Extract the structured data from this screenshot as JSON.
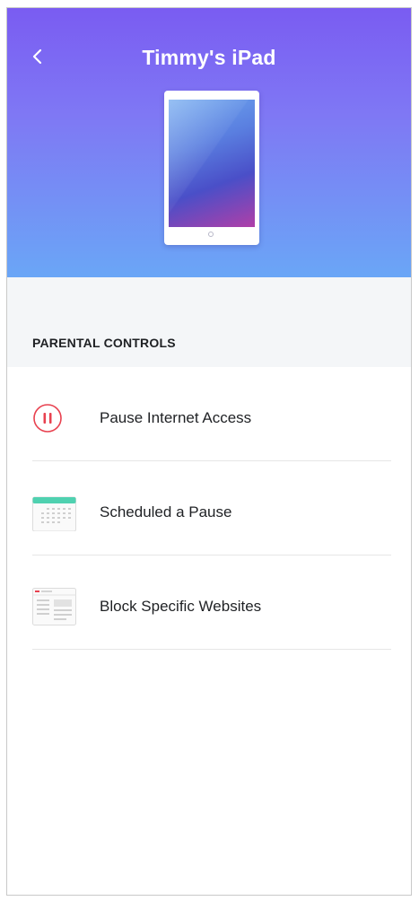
{
  "header": {
    "title": "Timmy's iPad"
  },
  "section": {
    "label": "PARENTAL CONTROLS"
  },
  "menu": {
    "items": [
      {
        "label": "Pause Internet Access",
        "icon": "pause-icon"
      },
      {
        "label": "Scheduled a Pause",
        "icon": "calendar-icon"
      },
      {
        "label": "Block Specific Websites",
        "icon": "webpage-icon"
      }
    ]
  },
  "colors": {
    "header_gradient_top": "#7a5cf2",
    "header_gradient_bottom": "#6aa6f6",
    "pause_red": "#e8414f",
    "calendar_teal": "#4fd1b0"
  }
}
